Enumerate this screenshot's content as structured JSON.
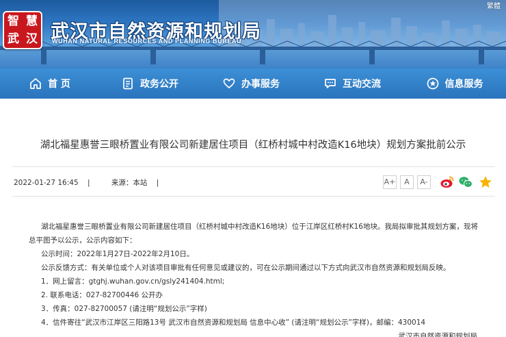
{
  "header": {
    "lang_toggle": "繁體",
    "logo_chars": [
      "智",
      "慧",
      "武",
      "汉"
    ],
    "title": "武汉市自然资源和规划局",
    "subtitle": "WUHAN NATURAL RESOURCES AND PLANNING BUREAU"
  },
  "nav": {
    "items": [
      {
        "label": "首 页",
        "icon": "home-icon"
      },
      {
        "label": "政务公开",
        "icon": "document-icon"
      },
      {
        "label": "办事服务",
        "icon": "heart-hands-icon"
      },
      {
        "label": "互动交流",
        "icon": "chat-icon"
      },
      {
        "label": "信息服务",
        "icon": "info-circle-icon"
      }
    ]
  },
  "article": {
    "title": "湖北福星惠誉三眼桥置业有限公司新建居住项目（红桥村城中村改造K16地块）规划方案批前公示",
    "date": "2022-01-27 16:45",
    "separator": "|",
    "source": "来源：本站",
    "font_sizes": [
      "A+",
      "A",
      "A-"
    ],
    "share_icons": [
      "weibo-icon",
      "wechat-icon",
      "favorite-star-icon"
    ],
    "intro": "湖北福星惠誉三眼桥置业有限公司新建居住项目（红桥村城中村改造K16地块）位于江岸区红桥村K16地块。我局拟审批其规划方案，现将总平图予以公示，公示内容如下：",
    "period": "公示时间：2022年1月27日-2022年2月10日。",
    "feedback": "公示反馈方式：有关单位或个人对该项目审批有任何意见或建议的，可在公示期间通过以下方式向武汉市自然资源和规划局反映。",
    "methods": [
      "1．网上留言：gtghj.wuhan.gov.cn/gsly241404.html;",
      "2. 联系电话：027-82700446    公开办",
      "3．传真：027-82700057 (请注明“规划公示”字样)",
      "4．信件寄往“武汉市江岸区三阳路13号 武汉市自然资源和规划局 信息中心收” (请注明“规划公示”字样)，邮编：430014"
    ],
    "signature": "武汉市自然资源和规划局"
  },
  "colors": {
    "nav_bg": "#2f7cc4",
    "logo_red": "#c9171e",
    "weibo": "#e6162d",
    "wechat": "#2aae67",
    "star": "#f5b400"
  }
}
